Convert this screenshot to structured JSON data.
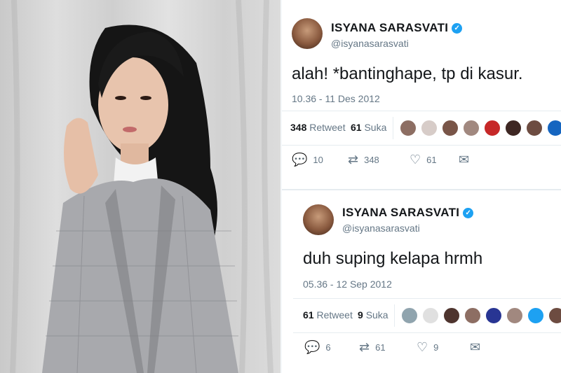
{
  "photo": {
    "subject": "Portrait of woman in grey plaid blazer"
  },
  "tweets": [
    {
      "name": "ISYANA SARASVATI",
      "handle": "@isyanasarasvati",
      "text": "alah! *bantinghape, tp di kasur.",
      "time": "10.36 - 11 Des 2012",
      "retweet_count": "348",
      "retweet_label": "Retweet",
      "like_count": "61",
      "like_label": "Suka",
      "reply": "10",
      "retweet": "348",
      "like": "61",
      "faces": [
        "#8d6e63",
        "#d7ccc8",
        "#795548",
        "#a1887f",
        "#c62828",
        "#3e2723",
        "#6d4c41",
        "#1565c0",
        "#5d4037"
      ]
    },
    {
      "name": "ISYANA SARASVATI",
      "handle": "@isyanasarasvati",
      "text": "duh suping kelapa hrmh",
      "time": "05.36 - 12 Sep 2012",
      "retweet_count": "61",
      "retweet_label": "Retweet",
      "like_count": "9",
      "like_label": "Suka",
      "reply": "6",
      "retweet": "61",
      "like": "9",
      "faces": [
        "#90a4ae",
        "#e0e0e0",
        "#4e342e",
        "#8d6e63",
        "#283593",
        "#a1887f",
        "#1da1f2",
        "#6d4c41"
      ]
    }
  ],
  "icons": {
    "verified": "✓",
    "reply": "💬",
    "retweet": "⇄",
    "like": "♡",
    "dm": "✉"
  },
  "colors": {
    "accent": "#1da1f2",
    "muted": "#657786",
    "text": "#14171a"
  }
}
